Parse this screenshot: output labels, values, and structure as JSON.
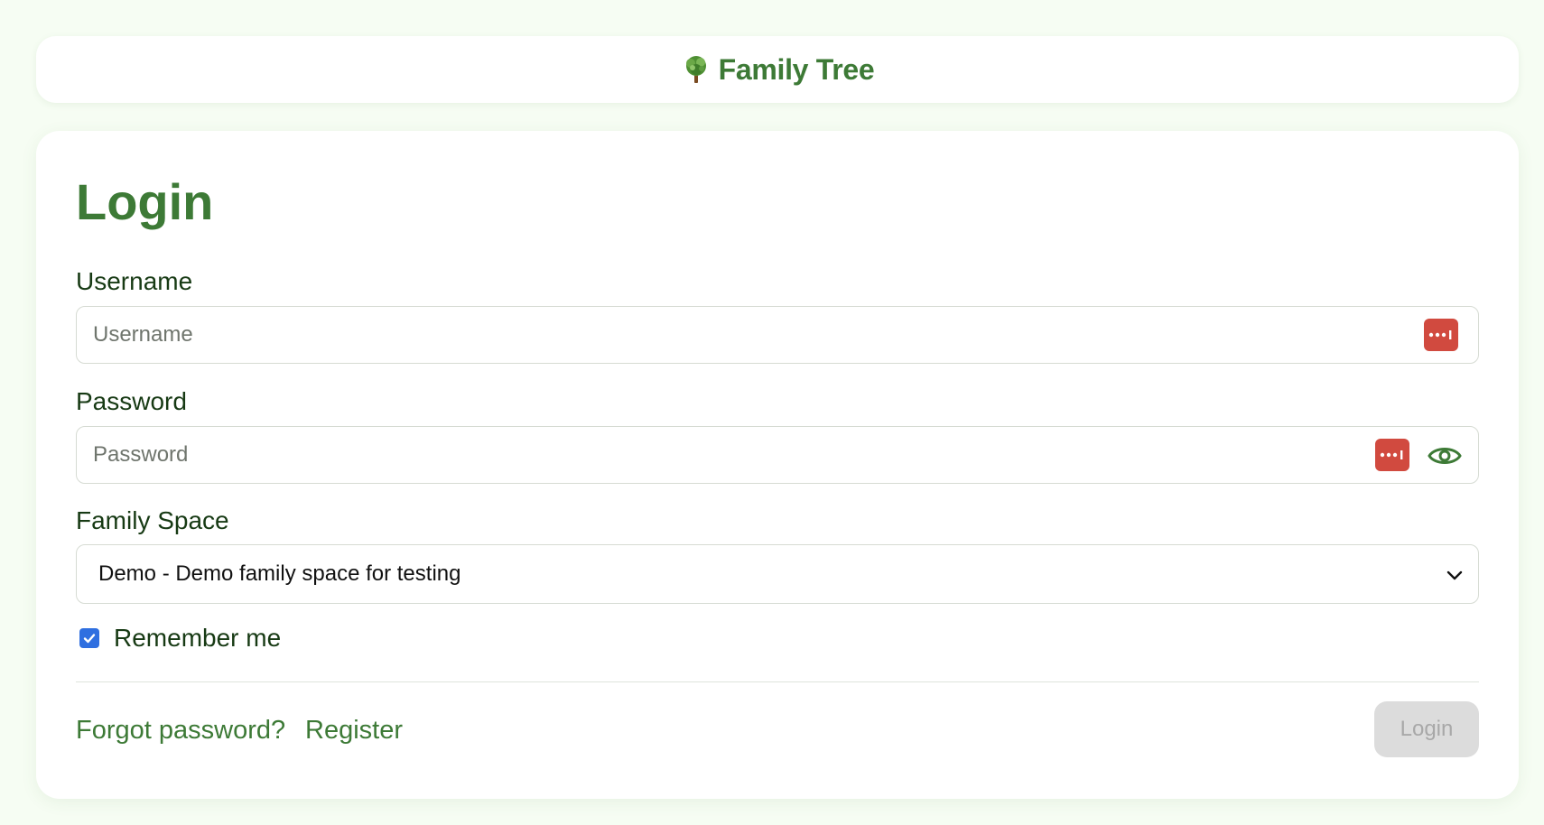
{
  "header": {
    "brand_icon": "tree-icon",
    "title": "Family Tree"
  },
  "login": {
    "title": "Login",
    "username": {
      "label": "Username",
      "placeholder": "Username",
      "value": "",
      "icon": "password-manager-icon"
    },
    "password": {
      "label": "Password",
      "placeholder": "Password",
      "value": "",
      "icons": [
        "password-manager-icon",
        "eye-icon"
      ]
    },
    "family_space": {
      "label": "Family Space",
      "selected": "Demo - Demo family space for testing"
    },
    "remember_me": {
      "label": "Remember me",
      "checked": true
    },
    "links": {
      "forgot_password": "Forgot password?",
      "register": "Register"
    },
    "submit_label": "Login"
  },
  "colors": {
    "brand_green": "#3d7a36",
    "background": "#f6fdf3",
    "password_manager_red": "#d14a3f",
    "checkbox_blue": "#2f6fe0",
    "disabled_button": "#dcdcdc"
  }
}
